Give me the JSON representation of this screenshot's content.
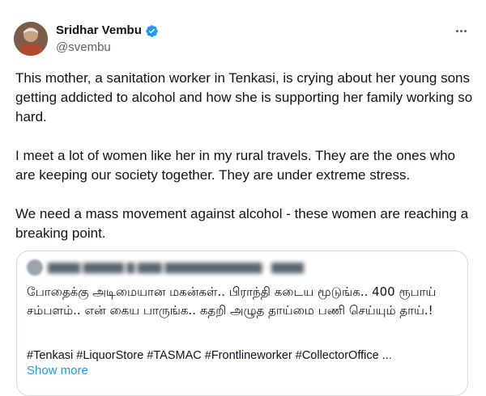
{
  "author": {
    "display_name": "Sridhar Vembu",
    "handle": "@svembu",
    "verified_icon": "verified-badge-icon",
    "verified_color": "#1d9bf0"
  },
  "menu": {
    "icon": "more-horizontal-icon"
  },
  "tweet": {
    "paragraphs": [
      "This mother, a sanitation worker in Tenkasi, is crying about her young sons getting addicted to alcohol and how she is supporting her family working so hard.",
      "I meet a lot of women like her in my rural travels. They are the ones who are keeping our society together. They are under extreme stress.",
      "We need a mass movement against alcohol - these women are reaching a breaking point."
    ]
  },
  "quoted_tweet": {
    "text": "போதைக்கு அடிமையான மகன்கள்.. பிராந்தி கடைய மூடுங்க.. 400 ரூபாய் சம்பளம்.. என் கைய பாருங்க.. கதறி அழுத தாய்மை பணி செய்யும் தாய்.!",
    "hashtags": "#Tenkasi #LiquorStore #TASMAC #Frontlineworker #CollectorOffice ...",
    "show_more_label": "Show more",
    "link_color": "#1d9bf0"
  }
}
